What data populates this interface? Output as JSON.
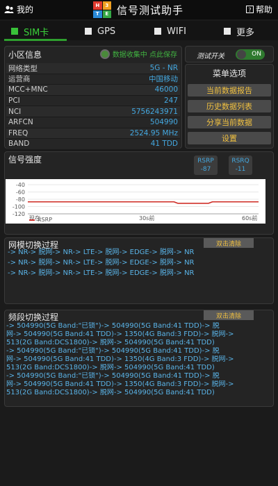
{
  "topbar": {
    "left_label": "我的",
    "logo_letters": [
      "H",
      "3",
      "T",
      "E"
    ],
    "title": "信号测试助手",
    "right_label": "帮助"
  },
  "tabs": [
    {
      "label": "SIM卡",
      "active": true
    },
    {
      "label": "GPS",
      "active": false
    },
    {
      "label": "WIFI",
      "active": false
    },
    {
      "label": "更多",
      "active": false
    }
  ],
  "cell": {
    "title": "小区信息",
    "collect_label": "数据收集中 点此保存",
    "rows": [
      {
        "k": "网络类型",
        "v": "5G - NR"
      },
      {
        "k": "运营商",
        "v": "中国移动"
      },
      {
        "k": "MCC+MNC",
        "v": "46000"
      },
      {
        "k": "PCI",
        "v": "247"
      },
      {
        "k": "NCI",
        "v": "5756243971"
      },
      {
        "k": "ARFCN",
        "v": "504990"
      },
      {
        "k": "FREQ",
        "v": "2524.95 MHz"
      },
      {
        "k": "BAND",
        "v": "41 TDD"
      }
    ]
  },
  "test_switch": {
    "label": "测试开关",
    "state": "ON"
  },
  "menu": {
    "title": "菜单选项",
    "buttons": [
      "当前数据报告",
      "历史数据列表",
      "分享当前数据",
      "设置"
    ]
  },
  "signal": {
    "title": "信号强度",
    "rsrp_label": "RSRP",
    "rsrp_value": "-87",
    "rsrq_label": "RSRQ",
    "rsrq_value": "-11"
  },
  "chart_data": {
    "type": "line",
    "y_ticks": [
      "-40",
      "-60",
      "-80",
      "-100",
      "-120"
    ],
    "x_ticks": [
      "现在",
      "30s前",
      "60s前"
    ],
    "ylim": [
      -120,
      -40
    ],
    "series": [
      {
        "name": "RSRP",
        "color": "#d0302a",
        "values": [
          -87,
          -87,
          -87,
          -87,
          -87,
          -87,
          -87,
          -87,
          -87,
          -87,
          -87,
          -87,
          -87,
          -87,
          -87,
          -87,
          -87,
          -87,
          -87,
          -87,
          -87,
          -87,
          -87,
          -87,
          -87,
          -87,
          -87,
          -87,
          -87,
          -87,
          -87,
          -87,
          -87,
          -87,
          -87,
          -87,
          -87,
          -87,
          -87,
          -91,
          -91,
          -91,
          -91,
          -91,
          -91,
          -91,
          -91,
          -91,
          -87,
          -87,
          -87,
          -87,
          -87,
          -87,
          -87,
          -87,
          -87,
          -87,
          -87,
          -87,
          -87
        ]
      }
    ],
    "legend": "bottom-left"
  },
  "network_switch": {
    "title": "网模切换过程",
    "clear_label": "双击清除",
    "lines": [
      "-> NR-> 脱网-> NR-> LTE-> 脱网-> EDGE-> 脱网-> NR",
      "-> NR-> 脱网-> NR-> LTE-> 脱网-> EDGE-> 脱网-> NR",
      "-> NR-> 脱网-> NR-> LTE-> 脱网-> EDGE-> 脱网-> NR"
    ]
  },
  "band_switch": {
    "title": "频段切换过程",
    "clear_label": "双击清除",
    "lines": [
      "-> 504990(5G Band:\"已锁\")-> 504990(5G Band:41 TDD)-> 脱",
      "网-> 504990(5G Band:41 TDD)-> 1350(4G Band:3 FDD)-> 脱网->",
      "513(2G Band:DCS1800)-> 脱网-> 504990(5G Band:41 TDD)",
      "-> 504990(5G Band:\"已锁\")-> 504990(5G Band:41 TDD)-> 脱",
      "网-> 504990(5G Band:41 TDD)-> 1350(4G Band:3 FDD)-> 脱网->",
      "513(2G Band:DCS1800)-> 脱网-> 504990(5G Band:41 TDD)",
      "-> 504990(5G Band:\"已锁\")-> 504990(5G Band:41 TDD)-> 脱",
      "网-> 504990(5G Band:41 TDD)-> 1350(4G Band:3 FDD)-> 脱网->",
      "513(2G Band:DCS1800)-> 脱网-> 504990(5G Band:41 TDD)"
    ]
  },
  "colors": {
    "accent_green": "#3ad13a",
    "value_blue": "#44a8e0",
    "button_yellow": "#f0c040",
    "line_red": "#d0302a"
  }
}
